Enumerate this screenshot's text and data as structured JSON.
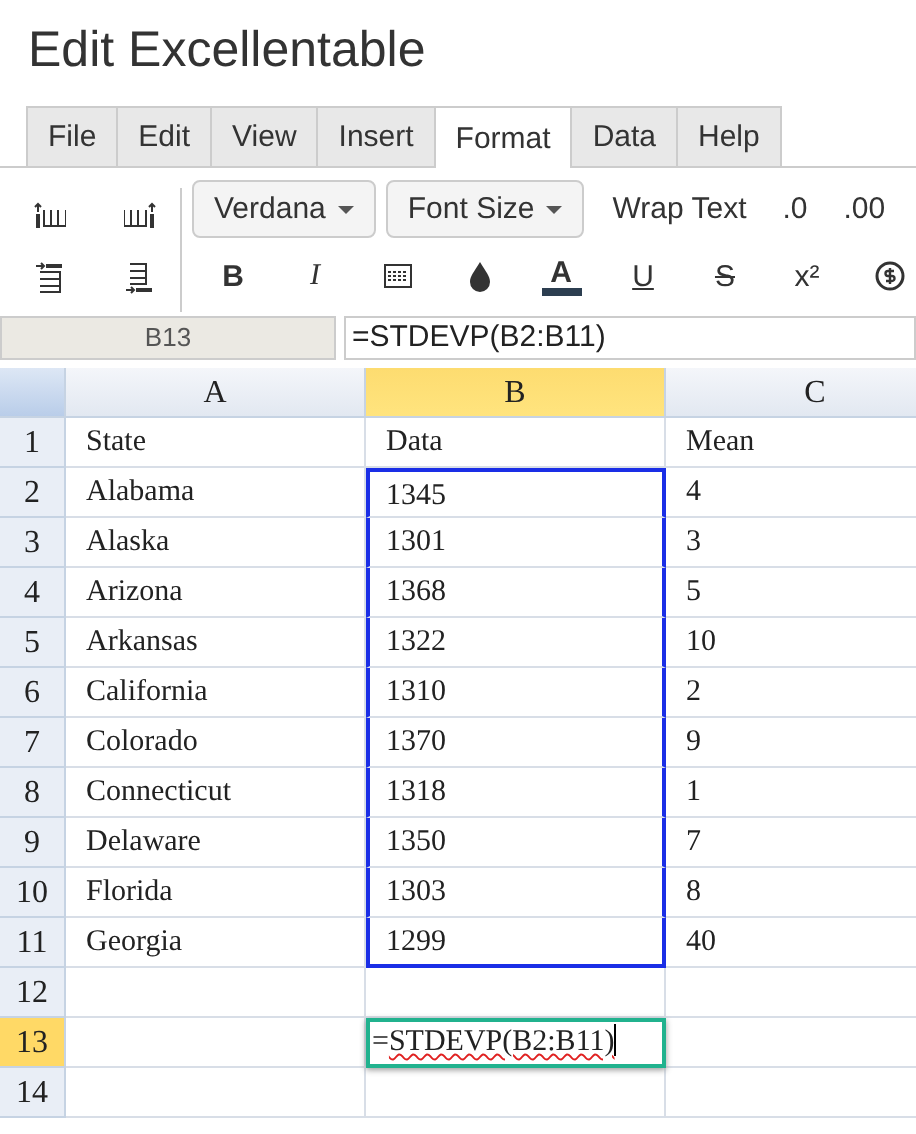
{
  "window": {
    "title": "Edit Excellentable"
  },
  "menu_tabs": [
    {
      "label": "File",
      "selected": false
    },
    {
      "label": "Edit",
      "selected": false
    },
    {
      "label": "View",
      "selected": false
    },
    {
      "label": "Insert",
      "selected": false
    },
    {
      "label": "Format",
      "selected": true
    },
    {
      "label": "Data",
      "selected": false
    },
    {
      "label": "Help",
      "selected": false
    }
  ],
  "toolbar": {
    "row_1": [
      {
        "kind": "dropdown",
        "label": "Verdana"
      },
      {
        "kind": "dropdown",
        "label": "Font Size"
      },
      {
        "kind": "text",
        "label": "Wrap Text"
      },
      {
        "kind": "text",
        "label": ".0"
      },
      {
        "kind": "text",
        "label": ".00"
      }
    ],
    "row_2": [
      {
        "kind": "bold",
        "label": "B"
      },
      {
        "kind": "italic",
        "label": "I"
      },
      {
        "kind": "borders"
      },
      {
        "kind": "fill"
      },
      {
        "kind": "color",
        "label": "A"
      },
      {
        "kind": "underline",
        "label": "U"
      },
      {
        "kind": "strike",
        "label": "S"
      },
      {
        "kind": "text",
        "label": "x²"
      },
      {
        "kind": "currency"
      }
    ]
  },
  "formula_bar": {
    "cell_ref": "B13",
    "formula": "=STDEVP(B2:B11)"
  },
  "columns": [
    {
      "label": "A",
      "selected": false
    },
    {
      "label": "B",
      "selected": true
    },
    {
      "label": "C",
      "selected": false
    }
  ],
  "rows": [
    {
      "number": "1",
      "selected": false,
      "cells": [
        {
          "value": "State"
        },
        {
          "value": "Data"
        },
        {
          "value": "Mean"
        }
      ]
    },
    {
      "number": "2",
      "selected": false,
      "cells": [
        {
          "value": "Alabama"
        },
        {
          "value": "1345",
          "in_range": true
        },
        {
          "value": "4"
        }
      ]
    },
    {
      "number": "3",
      "selected": false,
      "cells": [
        {
          "value": "Alaska"
        },
        {
          "value": "1301",
          "in_range": true
        },
        {
          "value": "3"
        }
      ]
    },
    {
      "number": "4",
      "selected": false,
      "cells": [
        {
          "value": "Arizona"
        },
        {
          "value": "1368",
          "in_range": true
        },
        {
          "value": "5"
        }
      ]
    },
    {
      "number": "5",
      "selected": false,
      "cells": [
        {
          "value": "Arkansas"
        },
        {
          "value": "1322",
          "in_range": true
        },
        {
          "value": "10"
        }
      ]
    },
    {
      "number": "6",
      "selected": false,
      "cells": [
        {
          "value": "California"
        },
        {
          "value": "1310",
          "in_range": true
        },
        {
          "value": "2"
        }
      ]
    },
    {
      "number": "7",
      "selected": false,
      "cells": [
        {
          "value": "Colorado"
        },
        {
          "value": "1370",
          "in_range": true
        },
        {
          "value": "9"
        }
      ]
    },
    {
      "number": "8",
      "selected": false,
      "cells": [
        {
          "value": "Connecticut"
        },
        {
          "value": "1318",
          "in_range": true
        },
        {
          "value": "1"
        }
      ]
    },
    {
      "number": "9",
      "selected": false,
      "cells": [
        {
          "value": "Delaware"
        },
        {
          "value": "1350",
          "in_range": true
        },
        {
          "value": "7"
        }
      ]
    },
    {
      "number": "10",
      "selected": false,
      "cells": [
        {
          "value": "Florida"
        },
        {
          "value": "1303",
          "in_range": true
        },
        {
          "value": "8"
        }
      ]
    },
    {
      "number": "11",
      "selected": false,
      "cells": [
        {
          "value": "Georgia"
        },
        {
          "value": "1299",
          "in_range": true
        },
        {
          "value": "40"
        }
      ]
    },
    {
      "number": "12",
      "selected": false,
      "cells": [
        {},
        {},
        {}
      ]
    },
    {
      "number": "13",
      "selected": true,
      "cells": [
        {},
        {
          "value": "=STDEVP(B2:B11)",
          "editing": true
        },
        {}
      ]
    },
    {
      "number": "14",
      "selected": false,
      "cells": [
        {},
        {},
        {}
      ]
    }
  ]
}
